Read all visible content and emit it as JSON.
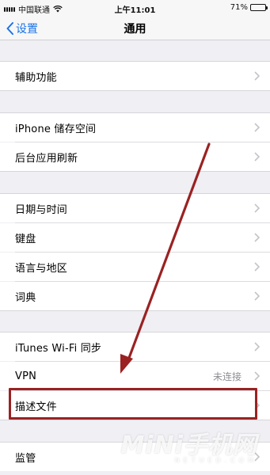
{
  "status_bar": {
    "carrier": "中国联通",
    "time": "上午11:01",
    "battery_label": "71%",
    "battery_level": 0.71
  },
  "nav": {
    "back_label": "设置",
    "title": "通用"
  },
  "rows": {
    "accessibility": "辅助功能",
    "iphone_storage": "iPhone 储存空间",
    "background_refresh": "后台应用刷新",
    "date_time": "日期与时间",
    "keyboard": "键盘",
    "language_region": "语言与地区",
    "dictionary": "词典",
    "itunes_wifi_sync": "iTunes Wi-Fi 同步",
    "vpn": "VPN",
    "vpn_status": "未连接",
    "profiles": "描述文件",
    "supervision": "监管"
  },
  "watermark": {
    "main": "MiNi手机网",
    "sub": "NETUED.COM"
  },
  "colors": {
    "accent": "#1a73e8",
    "annotation": "#9a2222",
    "background": "#efeff4"
  }
}
